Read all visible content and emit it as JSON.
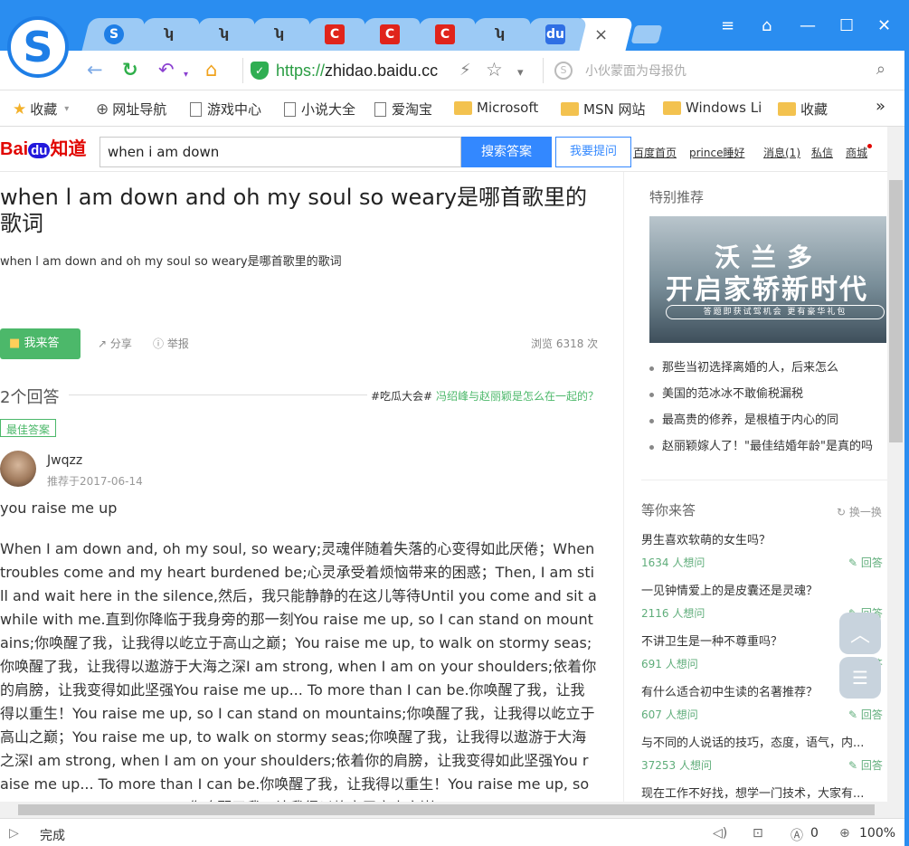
{
  "browser": {
    "logo_glyph": "S",
    "tabs": [
      {
        "icon": "sogou-icon",
        "glyph": "S",
        "cls": "ti-s"
      },
      {
        "icon": "hand-icon",
        "glyph": "ʮ",
        "cls": "ti-h"
      },
      {
        "icon": "hand-icon",
        "glyph": "ʮ",
        "cls": "ti-h"
      },
      {
        "icon": "hand-icon",
        "glyph": "ʮ",
        "cls": "ti-h"
      },
      {
        "icon": "c-red-icon",
        "glyph": "C",
        "cls": "ti-r"
      },
      {
        "icon": "c-red-icon",
        "glyph": "C",
        "cls": "ti-r"
      },
      {
        "icon": "c-red-icon",
        "glyph": "C",
        "cls": "ti-r"
      },
      {
        "icon": "hand-icon",
        "glyph": "ʮ",
        "cls": "ti-h"
      },
      {
        "icon": "baidu-paw-icon",
        "glyph": "du",
        "cls": "ti-p"
      }
    ],
    "tab_close": "×",
    "window_buttons": {
      "menu": "≡",
      "skin": "⌂",
      "minimize": "—",
      "maximize": "☐",
      "close": "✕"
    },
    "nav": {
      "back": "←",
      "refresh": "↻",
      "undo": "↶",
      "home": "⌂"
    },
    "url_scheme": "https://",
    "url_domain": "zhidao.baidu.cc",
    "url_lightning": "⚡",
    "url_star": "☆",
    "url_dropdown": "▾",
    "search_placeholder": "小伙蒙面为母报仇",
    "bookmarks": [
      {
        "label": "收藏",
        "icon": "star-icon"
      },
      {
        "label": "网址导航",
        "icon": "globe-icon"
      },
      {
        "label": "游戏中心",
        "icon": "page-icon"
      },
      {
        "label": "小说大全",
        "icon": "page-icon"
      },
      {
        "label": "爱淘宝",
        "icon": "page-icon"
      },
      {
        "label": "Microsoft",
        "icon": "folder-icon"
      },
      {
        "label": "MSN 网站",
        "icon": "folder-icon"
      },
      {
        "label": "Windows Li",
        "icon": "folder-icon"
      },
      {
        "label": "收藏",
        "icon": "folder-icon"
      }
    ],
    "bookmarks_more": "»"
  },
  "zhidao_header": {
    "logo_bai": "Bai",
    "logo_du": "du",
    "logo_zhidao": "知道",
    "search_value": "when i am down",
    "search_button": "搜索答案",
    "ask_button": "我要提问",
    "links": [
      "百度首页",
      "prince睡好",
      "消息(1)",
      "私信",
      "商城"
    ]
  },
  "question": {
    "title": "when l am down and oh my soul so weary是哪首歌里的歌词",
    "description": "when l am down and oh my soul so weary是哪首歌里的歌词",
    "answer_button": "我来答",
    "share": "分享",
    "report": "举报",
    "views": "浏览 6318 次"
  },
  "answers": {
    "count_label": "2个回答",
    "hot_tag": "#吃瓜大会#",
    "hot_link": "冯绍峰与赵丽颖是怎么在一起的？",
    "best_badge": "最佳答案",
    "user": "Jwqzz",
    "date": "推荐于2017-06-14",
    "short": "you raise me up",
    "body": "When I am down and, oh my soul, so weary;灵魂伴随着失落的心变得如此厌倦；When troubles come and my heart burdened be;心灵承受着烦恼带来的困惑；Then, I am still and wait here in the silence,然后，我只能静静的在这儿等待Until you come and sit awhile with me.直到你降临于我身旁的那一刻You raise me up, so I can stand on mountains;你唤醒了我，让我得以屹立于高山之巅；You raise me up, to walk on stormy seas;你唤醒了我，让我得以遨游于大海之深I am strong, when I am on your shoulders;依着你的肩膀，让我变得如此坚强You raise me up... To more than I can be.你唤醒了我，让我得以重生！You raise me up, so I can stand on mountains;你唤醒了我，让我得以屹立于高山之巅；You raise me up, to walk on stormy seas;你唤醒了我，让我得以遨游于大海之深I am strong, when I am on your shoulders;依着你的肩膀，让我变得如此坚强You raise me up... To more than I can be.你唤醒了我，让我得以重生！You raise me up, so I can stand on mountains;你唤醒了我，让我得以屹立于高山之巅；You raise me up, to walk on stormy seas;你唤醒了我，让我得以遨游于大海之深I am strong, when I am on your shoulders;依着你的肩膀，"
  },
  "sidebar": {
    "special_heading": "特别推荐",
    "ad_line1": "沃兰多",
    "ad_line2": "开启家轿新时代",
    "ad_line3": "答题即获试驾机会 更有豪华礼包",
    "recommendations": [
      "那些当初选择离婚的人，后来怎么",
      "美国的范冰冰不敢偷税漏税",
      "最高贵的修养，是根植于内心的同",
      "赵丽颖嫁人了！\"最佳结婚年龄\"是真的吗"
    ],
    "waiting_heading": "等你来答",
    "refresh_label": "换一换",
    "waiting": [
      {
        "q": "男生喜欢软萌的女生吗？",
        "count": "1634 人想问",
        "reply": "回答"
      },
      {
        "q": "一见钟情爱上的是皮囊还是灵魂？",
        "count": "2116 人想问",
        "reply": "回答"
      },
      {
        "q": "不讲卫生是一种不尊重吗？",
        "count": "691 人想问",
        "reply": "回答"
      },
      {
        "q": "有什么适合初中生读的名著推荐？",
        "count": "607 人想问",
        "reply": "回答"
      },
      {
        "q": "与不同的人说话的技巧，态度，语气，内...",
        "count": "37253 人想问",
        "reply": "回答"
      },
      {
        "q": "现在工作不好找，想学一门技术，大家有...",
        "count": "",
        "reply": ""
      }
    ]
  },
  "status": {
    "text": "完成",
    "adblock_count": "0",
    "zoom": "100%"
  }
}
